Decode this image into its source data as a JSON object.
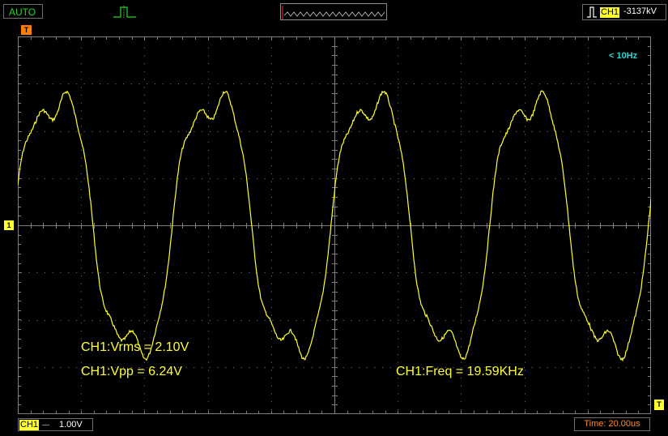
{
  "status": {
    "mode": "AUTO",
    "trigger_channel": "CH1",
    "trigger_level": "-3137kV",
    "trigger_marker": "T",
    "edge_icon": "rising-edge-icon"
  },
  "channel": {
    "name": "CH1",
    "ground_marker": "1",
    "coupling_icon": "dc-coupling-icon",
    "volts_per_div": "1.00V",
    "color": "#ffff2e"
  },
  "timebase": {
    "label": "Time: 20.00us",
    "color": "#ff8a2a"
  },
  "freq_indicator": "< 10Hz",
  "measurements": {
    "vrms": "CH1:Vrms = 2.10V",
    "vpp": "CH1:Vpp = 6.24V",
    "freq": "CH1:Freq = 19.59KHz"
  },
  "colors": {
    "background": "#000000",
    "grid": "#7f7f7f",
    "trace": "#ffff2e",
    "trigger_time_marker": "#ff7f00",
    "auto_text": "#2fd12f",
    "freq_indicator": "#2fd3d3"
  }
}
